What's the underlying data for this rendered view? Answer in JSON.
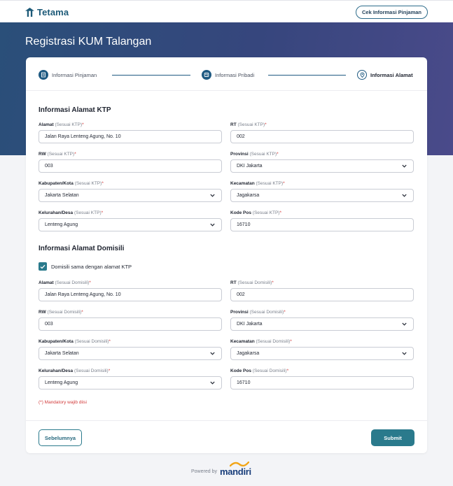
{
  "header": {
    "brand": "Tetama",
    "cek_button": "Cek Informasi Pinjaman"
  },
  "page_title": "Registrasi KUM Talangan",
  "steps": [
    {
      "label": "Informasi Pinjaman",
      "icon": "document-icon"
    },
    {
      "label": "Informasi Pribadi",
      "icon": "id-card-icon"
    },
    {
      "label": "Informasi Alamat",
      "icon": "location-icon",
      "active": true
    }
  ],
  "ktp": {
    "title": "Informasi Alamat KTP",
    "alamat": {
      "label": "Alamat",
      "hint": "(Sesuai KTP)",
      "req": "*",
      "value": "Jalan Raya Lenteng Agung, No. 10"
    },
    "rt": {
      "label": "RT",
      "hint": "(Sesuai KTP)",
      "req": "*",
      "value": "002"
    },
    "rw": {
      "label": "RW",
      "hint": "(Sesuai KTP)",
      "req": "*",
      "value": "003"
    },
    "provinsi": {
      "label": "Provinsi",
      "hint": "(Sesuai KTP)",
      "req": "*",
      "value": "DKI Jakarta"
    },
    "kabupaten": {
      "label": "Kabupaten/Kota",
      "hint": "(Sesuai KTP)",
      "req": "*",
      "value": "Jakarta Selatan"
    },
    "kecamatan": {
      "label": "Kecamatan",
      "hint": "(Sesuai KTP)",
      "req": "*",
      "value": "Jagakarsa"
    },
    "kelurahan": {
      "label": "Kelurahan/Desa",
      "hint": "(Sesuai KTP)",
      "req": "*",
      "value": "Lenteng Agung"
    },
    "kodepos": {
      "label": "Kode Pos",
      "hint": "(Sesuai KTP)",
      "req": "*",
      "value": "16710"
    }
  },
  "domisili": {
    "title": "Informasi Alamat Domisili",
    "same_checkbox_label": "Domisili sama dengan alamat KTP",
    "same_checked": true,
    "alamat": {
      "label": "Alamat",
      "hint": "(Sesuai Domisili)",
      "req": "*",
      "value": "Jalan Raya Lenteng Agung, No. 10"
    },
    "rt": {
      "label": "RT",
      "hint": "(Sesuai Domisili)",
      "req": "*",
      "value": "002"
    },
    "rw": {
      "label": "RW",
      "hint": "(Sesuai Domisili)",
      "req": "*",
      "value": "003"
    },
    "provinsi": {
      "label": "Provinsi",
      "hint": "(Sesuai Domisili)",
      "req": "*",
      "value": "DKI Jakarta"
    },
    "kabupaten": {
      "label": "Kabupaten/Kota",
      "hint": "(Sesuai Domisili)",
      "req": "*",
      "value": "Jakarta Selatan"
    },
    "kecamatan": {
      "label": "Kecamatan",
      "hint": "(Sesuai Domisili)",
      "req": "*",
      "value": "Jagakarsa"
    },
    "kelurahan": {
      "label": "Kelurahan/Desa",
      "hint": "(Sesuai Domisili)",
      "req": "*",
      "value": "Lenteng Agung"
    },
    "kodepos": {
      "label": "Kode Pos",
      "hint": "(Sesuai Domisili)",
      "req": "*",
      "value": "16710"
    }
  },
  "mandatory_note": "(*) Mandatory wajib diisi",
  "buttons": {
    "previous": "Sebelumnya",
    "submit": "Submit"
  },
  "footer": {
    "powered_by": "Powered by",
    "logo_text": "mandiri"
  },
  "colors": {
    "primary": "#2a7a8c",
    "navy": "#1f5a82",
    "required": "#d23b3b",
    "hero_start": "#2a4f79",
    "hero_end": "#4a4a8a"
  }
}
